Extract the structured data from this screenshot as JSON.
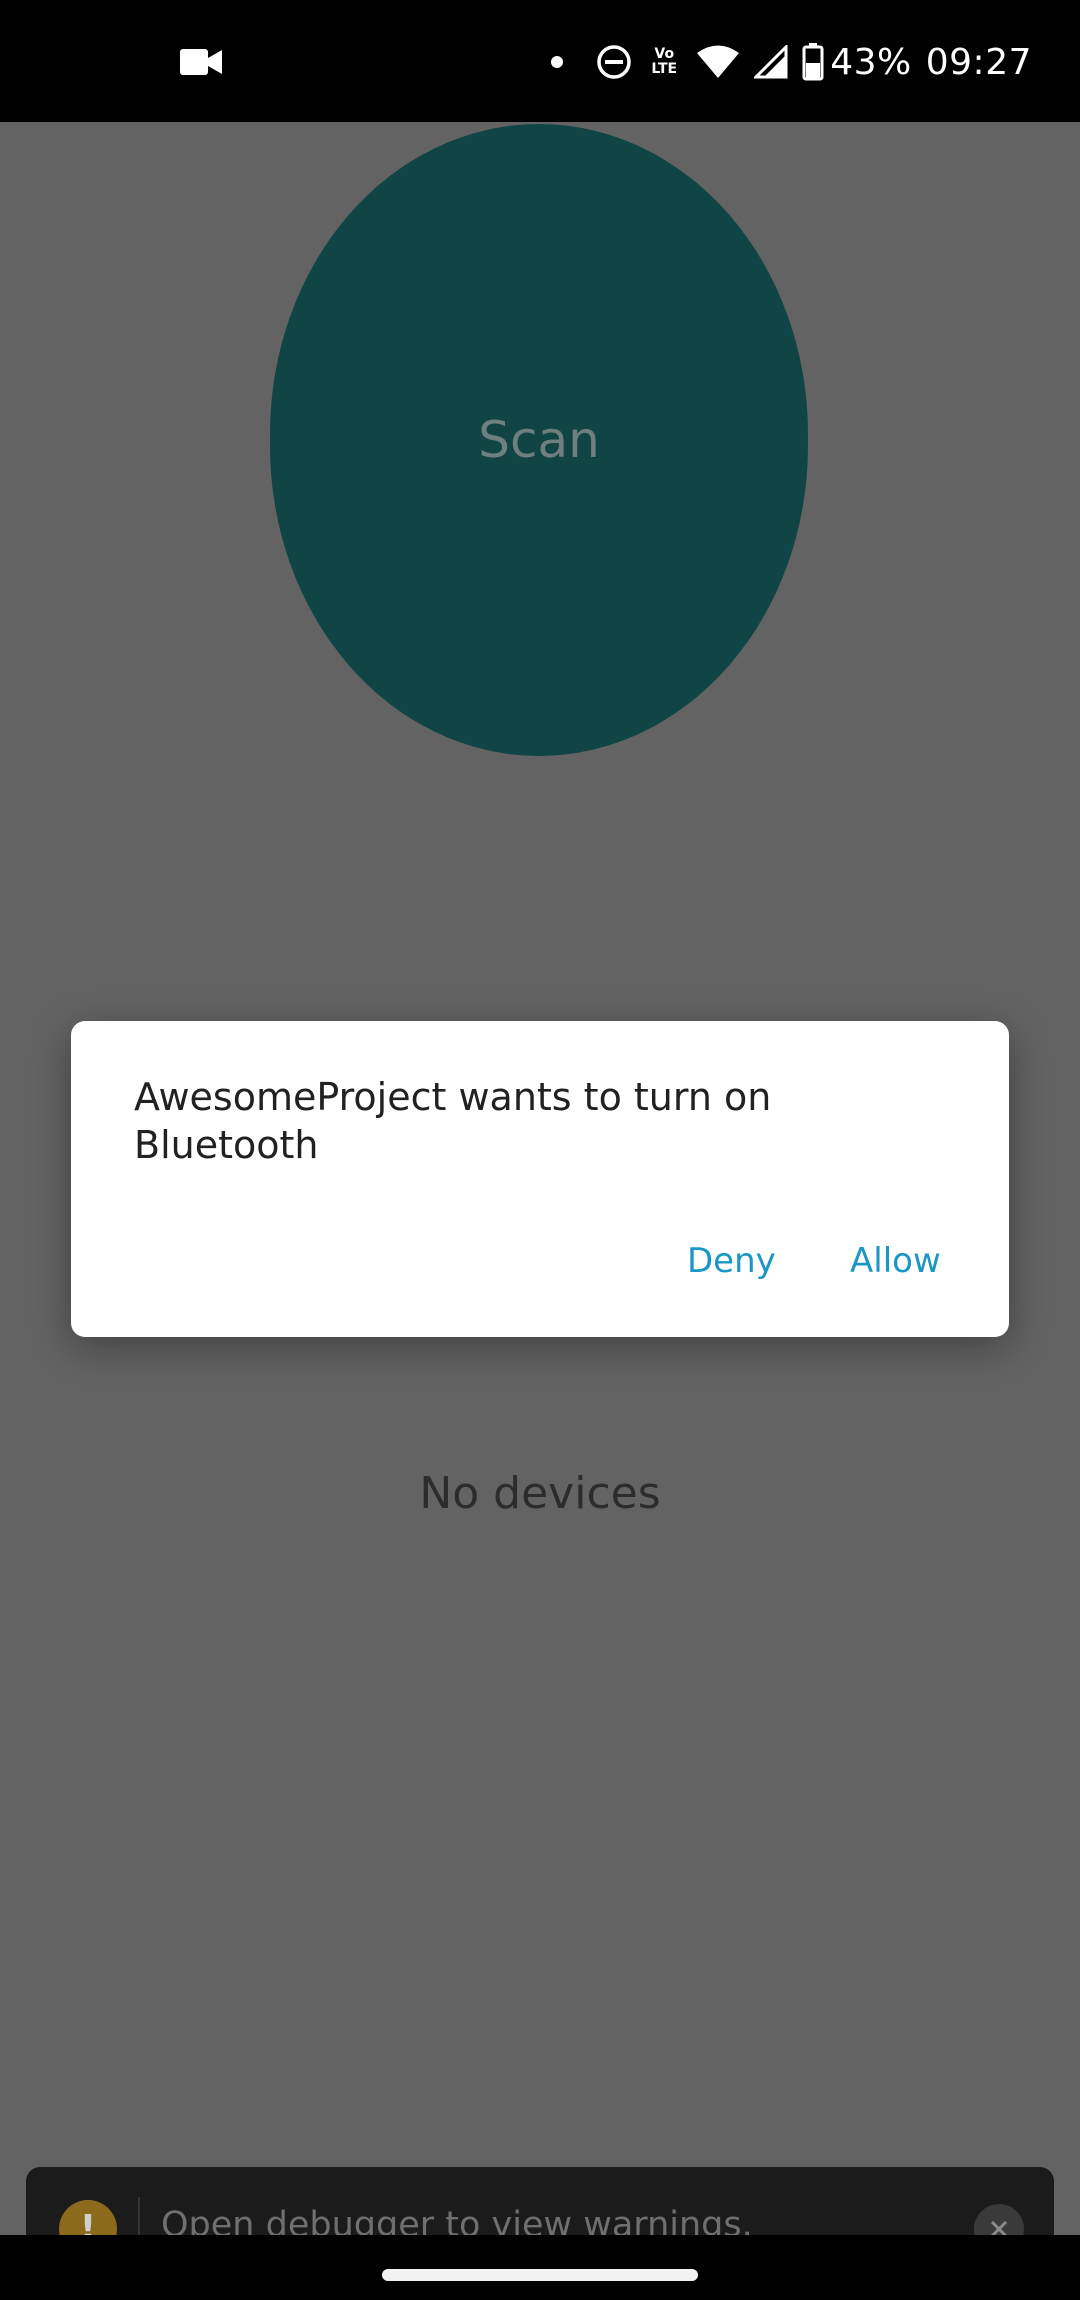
{
  "status_bar": {
    "battery": "43%",
    "time": "09:27",
    "volte_top": "Vo",
    "volte_bottom": "LTE",
    "icons": [
      "video-camera-icon",
      "notification-dot-icon",
      "do-not-disturb-icon",
      "volte-icon",
      "wifi-icon",
      "cell-signal-icon",
      "battery-icon"
    ]
  },
  "app": {
    "scan_label": "Scan",
    "empty_text": "No devices",
    "accent_color": "#114444"
  },
  "dialog": {
    "message": "AwesomeProject wants to turn on Bluetooth",
    "deny_label": "Deny",
    "allow_label": "Allow",
    "button_color": "#1a97c4"
  },
  "warning": {
    "icon_label": "!",
    "text": "Open debugger to view warnings."
  }
}
